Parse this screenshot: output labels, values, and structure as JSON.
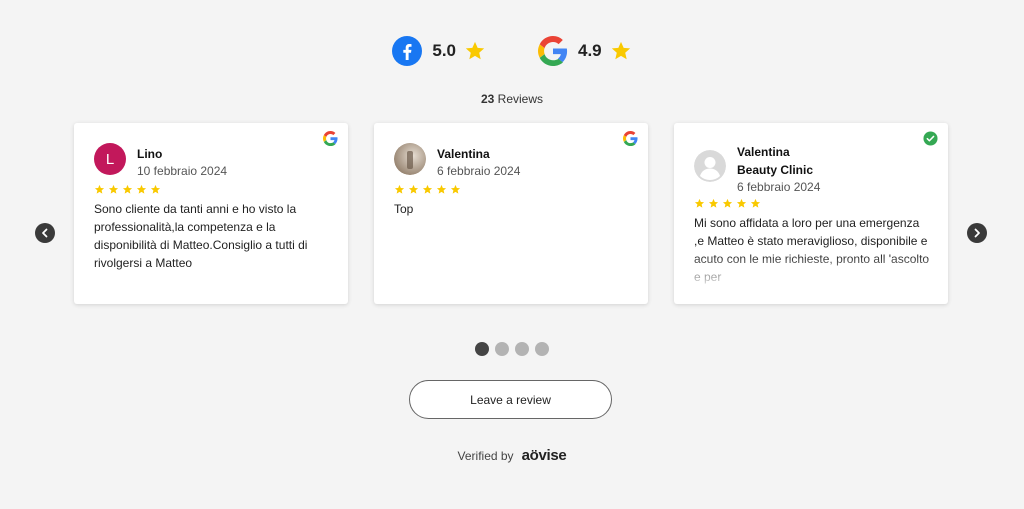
{
  "ratings": [
    {
      "platform_icon": "facebook-icon",
      "score": "5.0"
    },
    {
      "platform_icon": "google-icon",
      "score": "4.9"
    }
  ],
  "total": {
    "count": "23",
    "label": "Reviews"
  },
  "cards": [
    {
      "name": "Lino",
      "avatar_letter": "L",
      "date": "10 febbraio 2024",
      "rating": 5,
      "text": "Sono cliente da tanti anni e ho visto la professionalità,la competenza e la disponibilità di Matteo.Consiglio a tutti di rivolgersi a Matteo",
      "source_icon": "google-icon"
    },
    {
      "name": "Valentina",
      "date": "6 febbraio 2024",
      "rating": 5,
      "text": "Top",
      "source_icon": "google-icon"
    },
    {
      "name": "Valentina",
      "name_line2": "Beauty Clinic",
      "date": "6 febbraio 2024",
      "rating": 5,
      "text": "Mi sono affidata a loro per una emergenza ,e Matteo è stato meraviglioso, disponibile e acuto con le mie richieste, pronto all 'ascolto e per",
      "source_icon": "verified-check-icon"
    }
  ],
  "pagination": {
    "count": 4,
    "active": 1
  },
  "leave_review": "Leave a review",
  "verified_by": {
    "label": "Verified by",
    "brand": "aövise"
  },
  "colors": {
    "star": "#f9c900",
    "accent": "#c2185b",
    "background": "#f4f4f4"
  }
}
